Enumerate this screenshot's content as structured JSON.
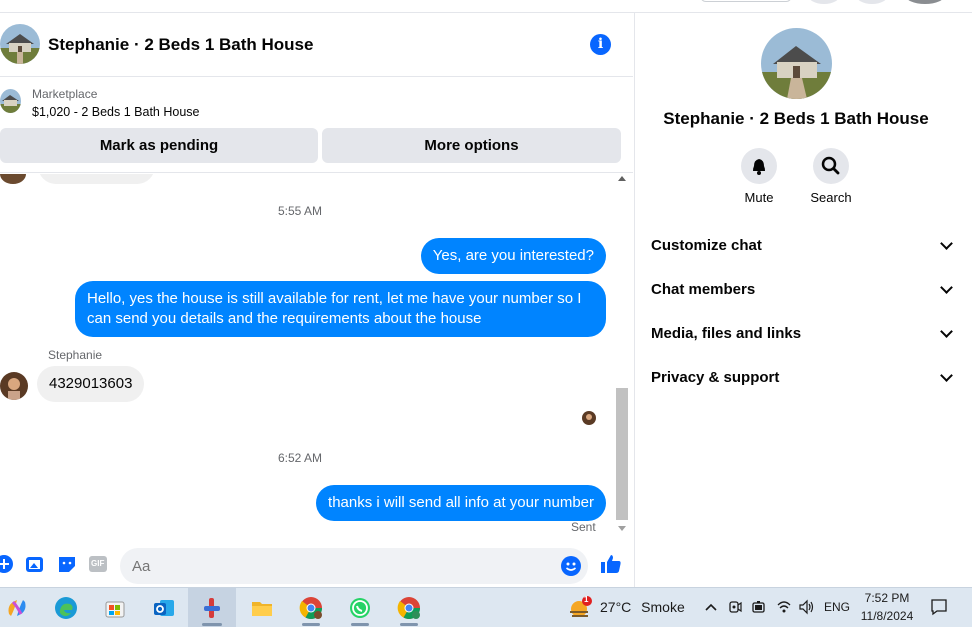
{
  "chat": {
    "title": "Stephanie · 2 Beds 1 Bath House",
    "listing": {
      "source": "Marketplace",
      "price_title": "$1,020 - 2 Beds 1 Bath House",
      "mark_pending": "Mark as pending",
      "more_options": "More options"
    },
    "messages": [
      {
        "type": "time",
        "text": "5:55 AM"
      },
      {
        "type": "out",
        "text": "Yes, are you interested?"
      },
      {
        "type": "out",
        "text": "Hello, yes the house is still available for rent, let me have your number so I can send you details and the requirements about the house"
      },
      {
        "type": "sender",
        "text": "Stephanie"
      },
      {
        "type": "in",
        "text": "4329013603"
      },
      {
        "type": "time",
        "text": "6:52 AM"
      },
      {
        "type": "out",
        "text": "thanks i will send all info at your number"
      },
      {
        "type": "status",
        "text": "Sent"
      }
    ],
    "composer": {
      "placeholder": "Aa",
      "gif_label": "GIF"
    }
  },
  "panel": {
    "title": "Stephanie · 2 Beds 1 Bath House",
    "actions": [
      {
        "label": "Mute",
        "icon": "bell-icon"
      },
      {
        "label": "Search",
        "icon": "search-icon"
      }
    ],
    "sections": [
      "Customize chat",
      "Chat members",
      "Media, files and links",
      "Privacy & support"
    ]
  },
  "taskbar": {
    "apps": [
      "copilot",
      "edge",
      "microsoft-store",
      "outlook",
      "app-red",
      "file-explorer",
      "chrome-profile-c",
      "whatsapp",
      "chrome"
    ],
    "weather": {
      "temp": "27°C",
      "condition": "Smoke",
      "badge": "1"
    },
    "language": "ENG",
    "time": "7:52 PM",
    "date": "11/8/2024"
  },
  "colors": {
    "accent": "#0866ff",
    "outgoing_bubble": "#0084ff",
    "incoming_bubble": "#f0f0f0",
    "button_gray": "#e4e6eb",
    "taskbar": "#dde7f1"
  }
}
